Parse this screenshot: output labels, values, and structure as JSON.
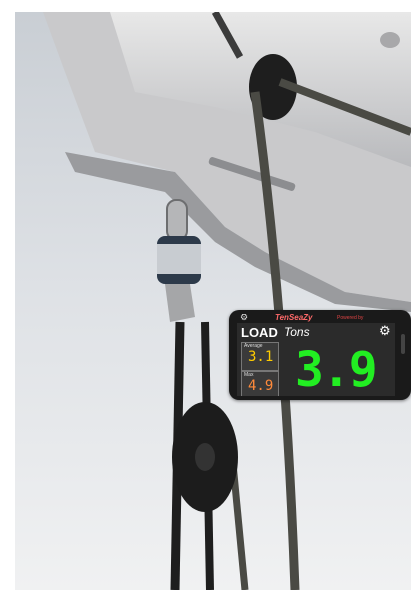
{
  "scene": {
    "description_items": [
      "boom",
      "shackle",
      "load-cell",
      "blocks",
      "ropes",
      "sky"
    ]
  },
  "app": {
    "brand": "TenSeaZy",
    "partner_label": "Powered by",
    "title": "LOAD",
    "units": "Tons",
    "average_label": "Average",
    "average_value": "3.1",
    "max_label": "Max",
    "max_value": "4.9",
    "main_value": "3.9",
    "settings_icon": "gear-icon",
    "settings_small_icon": "gear-icon"
  },
  "colors": {
    "display_green": "#22ee22",
    "average_yellow": "#ffcc00",
    "max_orange": "#ff8a3a",
    "brand_red": "#ff6a6a"
  }
}
